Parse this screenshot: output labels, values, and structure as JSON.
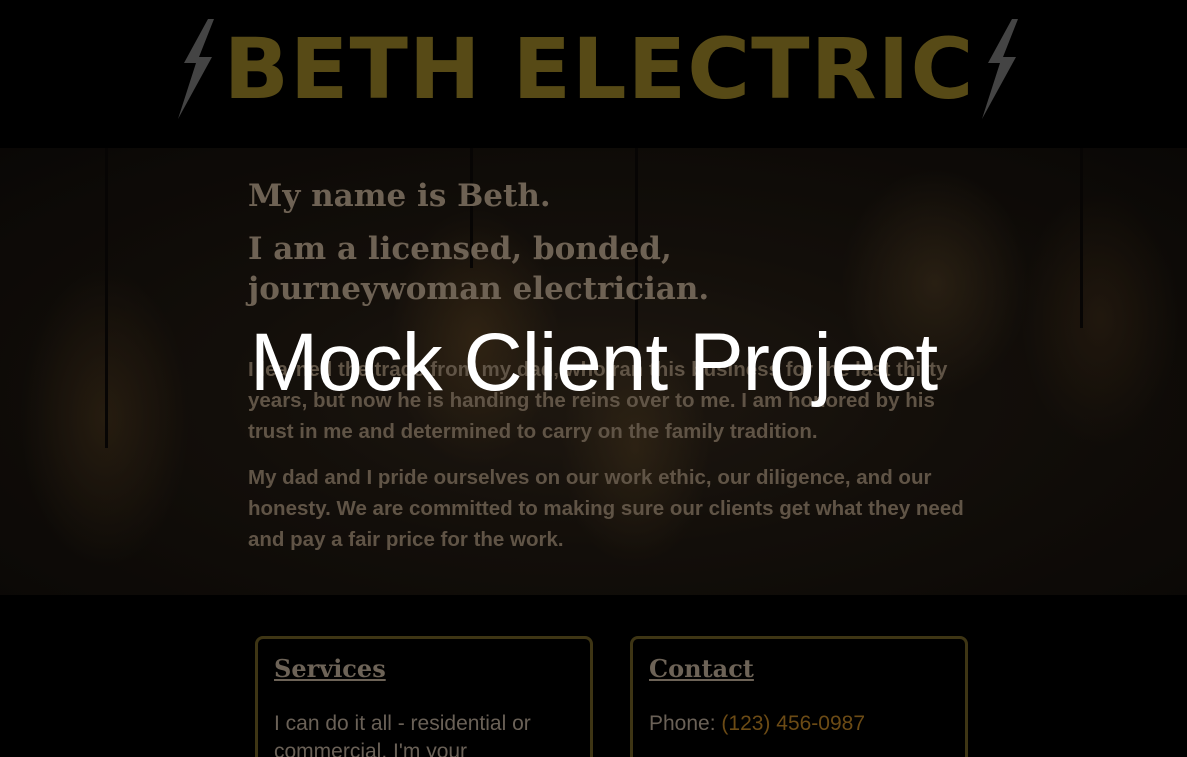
{
  "header": {
    "brand_name": "BETH ELECTRIC",
    "brand_color": "#574a16",
    "left_icon": "lightning-bolt-icon",
    "right_icon": "lightning-bolt-icon"
  },
  "hero": {
    "name_line": "My name is Beth.",
    "title_line": "I am a licensed, bonded, journeywoman electrician.",
    "paragraph_1": "I learned the trade from my dad, who ran this business for the last thirty years, but now he is handing the reins over to me. I am honored by his trust in me and determined to carry on the family tradition.",
    "paragraph_2": "My dad and I pride ourselves on our work ethic, our diligence, and our honesty. We are committed to making sure our clients get what they need and pay a fair price for the work."
  },
  "overlay": {
    "title": "Mock Client Project"
  },
  "services": {
    "title": "Services",
    "text": "I can do it all - residential or commercial. I'm your"
  },
  "contact": {
    "title": "Contact",
    "phone_label": "Phone:",
    "phone_value": "(123) 456-0987",
    "phone_color": "#6c4b15"
  }
}
